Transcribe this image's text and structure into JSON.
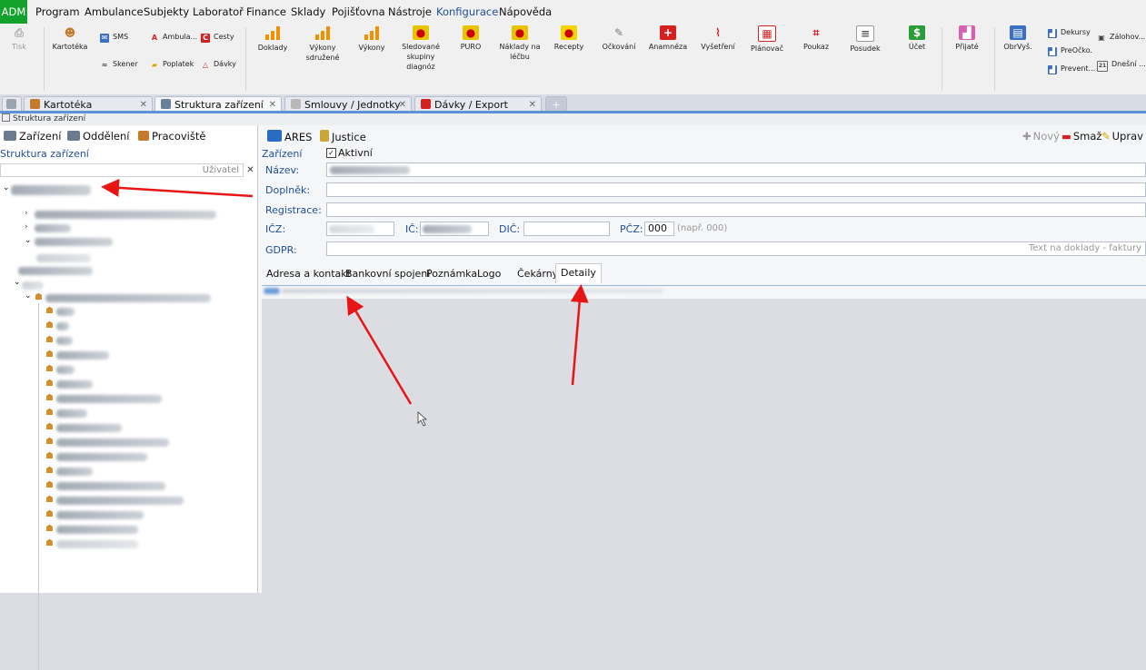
{
  "menu": [
    "ADM",
    "Program",
    "Ambulance",
    "Subjekty",
    "Laboratoř",
    "Finance",
    "Sklady",
    "Pojišťovna",
    "Nástroje",
    "Konfigurace",
    "Nápověda"
  ],
  "colors": {
    "accent": "#12a12a",
    "active_menu": "#1d4e9a",
    "label": "#1d4e9a",
    "arrow": "#e81515",
    "bars": "#f29000"
  },
  "ribbon": {
    "tisk": "Tisk",
    "kartoteka": "Kartotéka",
    "sms": "SMS",
    "skener": "Skener",
    "ambula": "Ambula...",
    "poplatek": "Poplatek",
    "cesty": "Cesty",
    "davky": "Dávky",
    "doklady": "Doklady",
    "vykony_sdruzene": "Výkony sdružené",
    "vykony": "Výkony",
    "sledovane": "Sledované skupiny diagnóz",
    "puro": "PURO",
    "naklady": "Náklady na léčbu",
    "recepty": "Recepty",
    "ockovani": "Očkování",
    "anamneza": "Anamnéza",
    "vysetreni": "Vyšetření",
    "planovac": "Plánovač",
    "poukaz": "Poukaz",
    "posudek": "Posudek",
    "ucet": "Účet",
    "prijate": "Přijaté",
    "obrvys": "ObrVyš.",
    "dekursy": "Dekursy",
    "preocko": "PreOčko.",
    "prevent": "Prevent...",
    "zalohov": "Záloh­ov...",
    "dnesni": "Dnešní ..."
  },
  "tabs": [
    {
      "label": "Kartotéka"
    },
    {
      "label": "Struktura zařízení"
    },
    {
      "label": "Smlouvy / Jednotky"
    },
    {
      "label": "Dávky / Export"
    }
  ],
  "breadcrumb": "Struktura zařízení",
  "left": {
    "btn_zarizeni": "Zařízení",
    "btn_oddeleni": "Oddělení",
    "btn_pracoviste": "Pracoviště",
    "section_title": "Struktura zařízení",
    "filter_placeholder": "Uživatel"
  },
  "right": {
    "btn_ares": "ARES",
    "btn_justice": "Justice",
    "btn_novy": "Nový",
    "btn_smaz": "Smaž",
    "btn_uprav": "Uprav",
    "label_zarizeni": "Zařízení",
    "label_aktivni": "Aktivní",
    "label_nazev": "Název:",
    "label_doplnek": "Doplněk:",
    "label_registrace": "Registrace:",
    "label_icz": "IČZ:",
    "label_ic": "IČ:",
    "label_dic": "DIČ:",
    "label_pcz": "PČZ:",
    "value_pcz": "000",
    "hint_pcz": "(např. 000)",
    "label_gdpr": "GDPR:",
    "gdpr_hint": "Text na doklady - faktury",
    "inner_tabs": [
      "Adresa a kontakt",
      "Bankovní spojení",
      "Poznámka",
      "Logo",
      "Čekárny",
      "Detaily"
    ]
  }
}
